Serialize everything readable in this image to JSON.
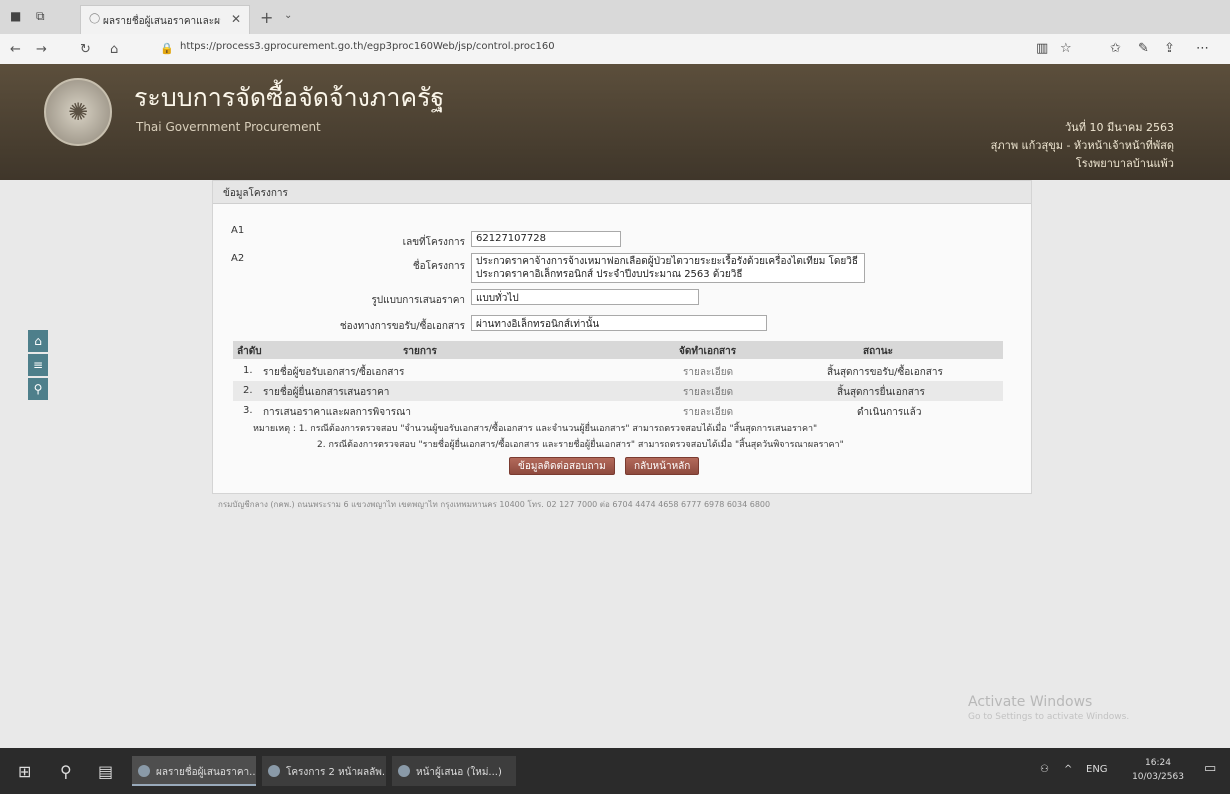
{
  "browser": {
    "tab_title": "ผลรายชื่อผู้เสนอราคาและผล",
    "url": "https://process3.gprocurement.go.th/egp3proc160Web/jsp/control.proc160"
  },
  "header": {
    "title": "ระบบการจัดซื้อจัดจ้างภาครัฐ",
    "subtitle": "Thai Government Procurement",
    "date": "วันที่ 10 มีนาคม 2563",
    "user": "สุภาพ แก้วสุขุม - หัวหน้าเจ้าหน้าที่พัสดุ",
    "org": "โรงพยาบาลบ้านแพ้ว"
  },
  "panel": {
    "title": "ข้อมูลโครงการ",
    "row_labels": [
      "A1",
      "A2"
    ],
    "fields": {
      "project_no_label": "เลขที่โครงการ",
      "project_no": "62127107728",
      "project_name_label": "ชื่อโครงการ",
      "project_name": "ประกวดราคาจ้างการจ้างเหมาฟอกเลือดผู้ป่วยไตวายระยะเรื้อรังด้วยเครื่องไตเทียม โดยวิธีประกวดราคาอิเล็กทรอนิกส์ ประจำปีงบประมาณ 2563 ด้วยวิธี",
      "bid_format_label": "รูปแบบการเสนอราคา",
      "bid_format": "แบบทั่วไป",
      "channel_label": "ช่องทางการขอรับ/ซื้อเอกสาร",
      "channel": "ผ่านทางอิเล็กทรอนิกส์เท่านั้น"
    },
    "table": {
      "headers": [
        "ลำดับ",
        "รายการ",
        "จัดทำเอกสาร",
        "สถานะ"
      ],
      "rows": [
        {
          "no": "1.",
          "item": "รายชื่อผู้ขอรับเอกสาร/ซื้อเอกสาร",
          "doc": "รายละเอียด",
          "status": "สิ้นสุดการขอรับ/ซื้อเอกสาร"
        },
        {
          "no": "2.",
          "item": "รายชื่อผู้ยื่นเอกสารเสนอราคา",
          "doc": "รายละเอียด",
          "status": "สิ้นสุดการยื่นเอกสาร"
        },
        {
          "no": "3.",
          "item": "การเสนอราคาและผลการพิจารณา",
          "doc": "รายละเอียด",
          "status": "ดำเนินการแล้ว"
        }
      ]
    },
    "notes": [
      "หมายเหตุ : 1. กรณีต้องการตรวจสอบ \"จำนวนผู้ขอรับเอกสาร/ซื้อเอกสาร และจำนวนผู้ยื่นเอกสาร\" สามารถตรวจสอบได้เมื่อ \"สิ้นสุดการเสนอราคา\"",
      "2. กรณีต้องการตรวจสอบ \"รายชื่อผู้ยื่นเอกสาร/ซื้อเอกสาร และรายชื่อผู้ยื่นเอกสาร\" สามารถตรวจสอบได้เมื่อ \"สิ้นสุดวันพิจารณาผลราคา\""
    ],
    "buttons": {
      "contact": "ข้อมูลติดต่อสอบถาม",
      "back": "กลับหน้าหลัก"
    }
  },
  "footer": "กรมบัญชีกลาง (กคพ.) ถนนพระราม 6 แขวงพญาไท เขตพญาไท กรุงเทพมหานคร 10400 โทร. 02 127 7000 ต่อ 6704 4474 4658 6777 6978 6034 6800",
  "activate": {
    "title": "Activate Windows",
    "sub": "Go to Settings to activate Windows."
  },
  "taskbar": {
    "apps": [
      "ผลรายชื่อผู้เสนอราคา...",
      "โครงการ 2 หน้าผลลัพ...",
      "หน้าผู้เสนอ (ใหม่...)"
    ],
    "lang": "ENG",
    "time": "16:24",
    "date": "10/03/2563"
  }
}
